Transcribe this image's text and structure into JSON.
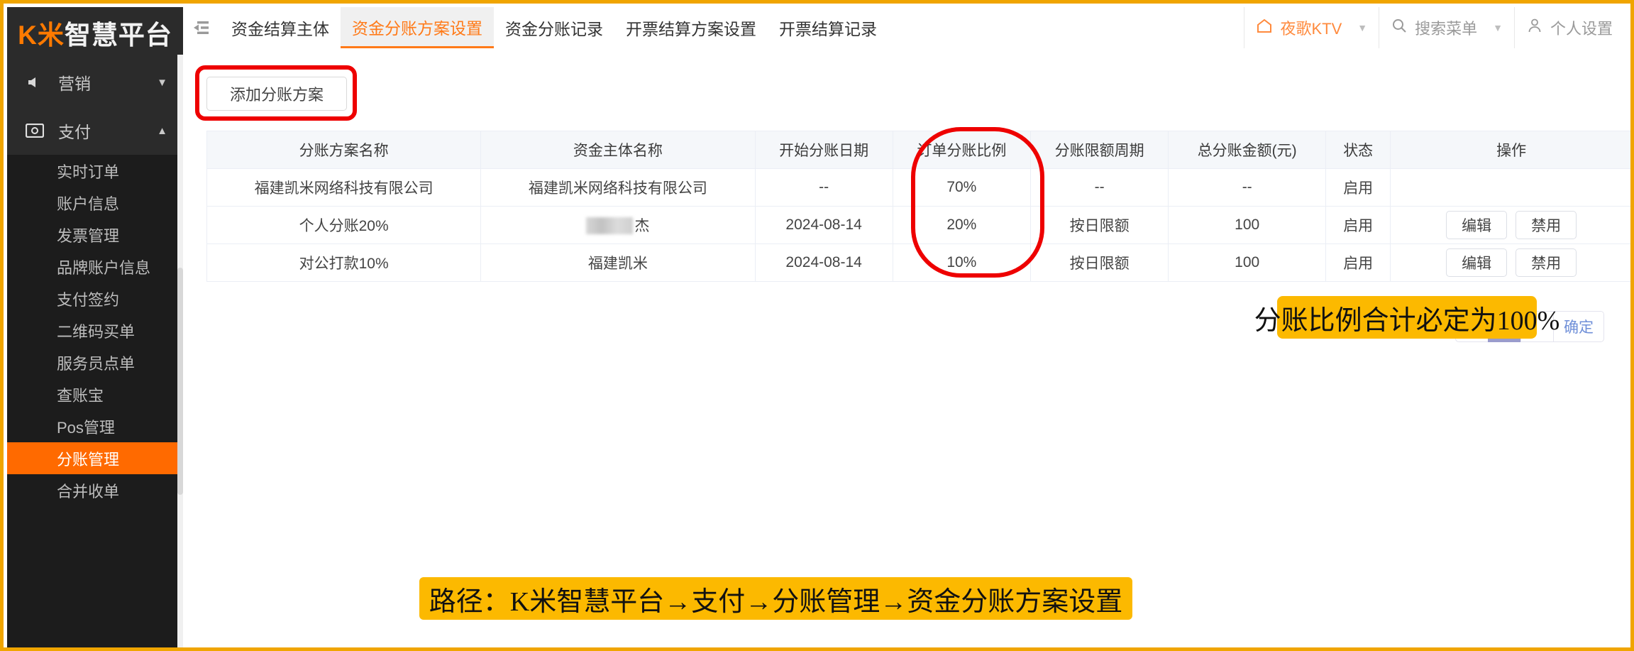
{
  "brand": {
    "prefix": "K米",
    "suffix": "智慧平台"
  },
  "sidebar": {
    "groups": [
      {
        "label": "营销",
        "icon": "megaphone-icon",
        "expanded": false,
        "caret": "▼"
      },
      {
        "label": "支付",
        "icon": "money-icon",
        "expanded": true,
        "caret": "▲"
      }
    ],
    "items": [
      {
        "label": "实时订单",
        "active": false
      },
      {
        "label": "账户信息",
        "active": false
      },
      {
        "label": "发票管理",
        "active": false
      },
      {
        "label": "品牌账户信息",
        "active": false
      },
      {
        "label": "支付签约",
        "active": false
      },
      {
        "label": "二维码买单",
        "active": false
      },
      {
        "label": "服务员点单",
        "active": false
      },
      {
        "label": "查账宝",
        "active": false
      },
      {
        "label": "Pos管理",
        "active": false
      },
      {
        "label": "分账管理",
        "active": true
      },
      {
        "label": "合并收单",
        "active": false
      }
    ]
  },
  "topbar": {
    "fold_icon": "menu-fold-icon",
    "tabs": [
      {
        "label": "资金结算主体",
        "active": false
      },
      {
        "label": "资金分账方案设置",
        "active": true
      },
      {
        "label": "资金分账记录",
        "active": false
      },
      {
        "label": "开票结算方案设置",
        "active": false
      },
      {
        "label": "开票结算记录",
        "active": false
      }
    ],
    "store": {
      "icon": "home-icon",
      "label": "夜歌KTV",
      "caret": "▼"
    },
    "search": {
      "icon": "search-icon",
      "placeholder": "搜索菜单",
      "value": "搜索菜单",
      "caret": "▼"
    },
    "profile": {
      "icon": "user-icon",
      "label": "个人设置"
    }
  },
  "toolbar": {
    "add_label": "添加分账方案"
  },
  "table": {
    "headers": [
      "分账方案名称",
      "资金主体名称",
      "开始分账日期",
      "订单分账比例",
      "分账限额周期",
      "总分账金额(元)",
      "状态",
      "操作"
    ],
    "rows": [
      {
        "plan_name": "福建凯米网络科技有限公司",
        "entity_name": "福建凯米网络科技有限公司",
        "entity_masked": false,
        "start_date": "--",
        "ratio": "70%",
        "limit_cycle": "--",
        "total_amount": "--",
        "status": "启用",
        "actions": []
      },
      {
        "plan_name": "个人分账20%",
        "entity_name": "杰",
        "entity_masked": true,
        "start_date": "2024-08-14",
        "ratio": "20%",
        "limit_cycle": "按日限额",
        "total_amount": "100",
        "status": "启用",
        "actions": [
          "编辑",
          "禁用"
        ]
      },
      {
        "plan_name": "对公打款10%",
        "entity_name": "福建凯米",
        "entity_masked": false,
        "start_date": "2024-08-14",
        "ratio": "10%",
        "limit_cycle": "按日限额",
        "total_amount": "100",
        "status": "启用",
        "actions": [
          "编辑",
          "禁用"
        ]
      }
    ]
  },
  "pagination": {
    "prev": "«",
    "current": "1",
    "blank": "",
    "confirm": "确定"
  },
  "annotations": {
    "ratio_note": "分账比例合计必定为100%",
    "path_note": "路径：K米智慧平台→支付→分账管理→资金分账方案设置",
    "highlight_color": "#fcb900",
    "circle_color": "#ee0000"
  }
}
